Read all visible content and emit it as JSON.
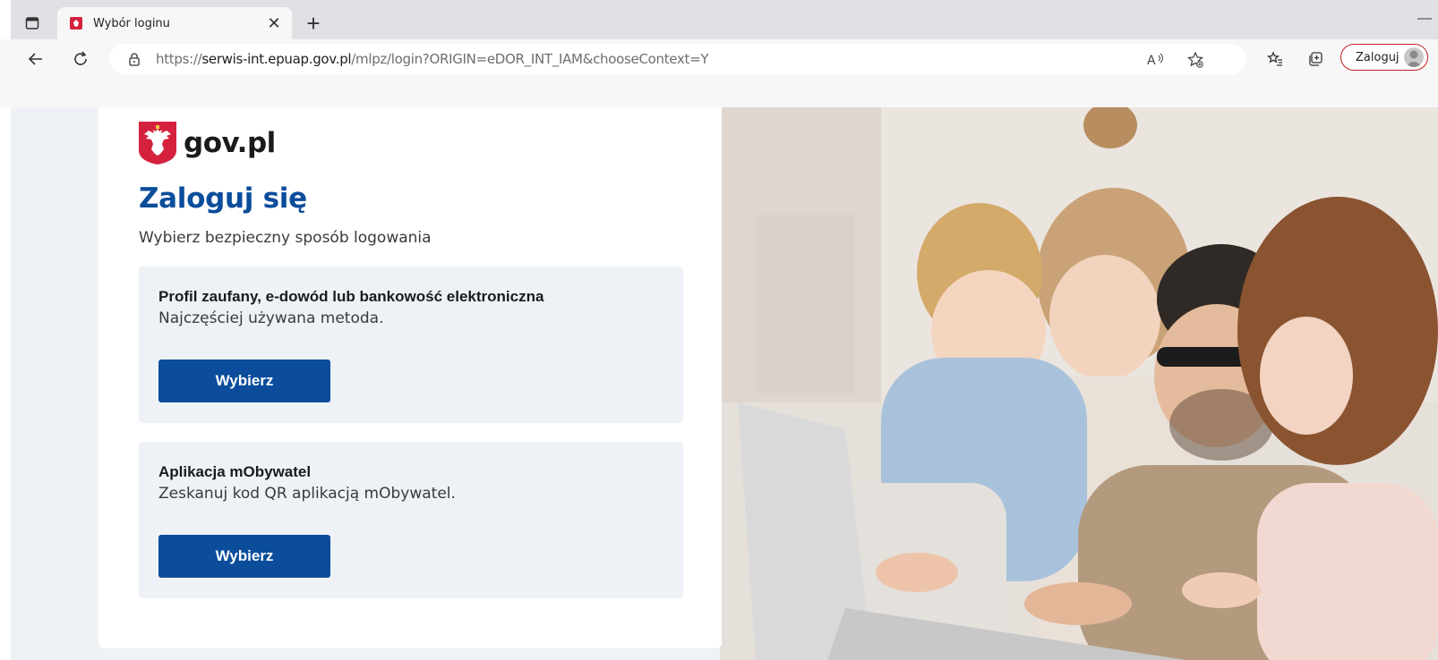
{
  "browser": {
    "tab": {
      "title": "Wybór loginu"
    },
    "address": {
      "scheme": "https://",
      "host": "serwis-int.epuap.gov.pl",
      "path": "/mlpz/login?ORIGIN=eDOR_INT_IAM&chooseContext=Y"
    },
    "profile_label": "Zaloguj",
    "accent": "#c5221f"
  },
  "page": {
    "logo_text": "gov.pl",
    "heading": "Zaloguj się",
    "subheading": "Wybierz bezpieczny sposób logowania",
    "options": [
      {
        "title": "Profil zaufany, e-dowód lub bankowość elektroniczna",
        "description": "Najczęściej używana metoda.",
        "button_label": "Wybierz"
      },
      {
        "title": "Aplikacja mObywatel",
        "description": "Zeskanuj kod QR aplikacją mObywatel.",
        "button_label": "Wybierz"
      }
    ],
    "colors": {
      "primary": "#0b4d9b",
      "background": "#eef2f6"
    }
  }
}
